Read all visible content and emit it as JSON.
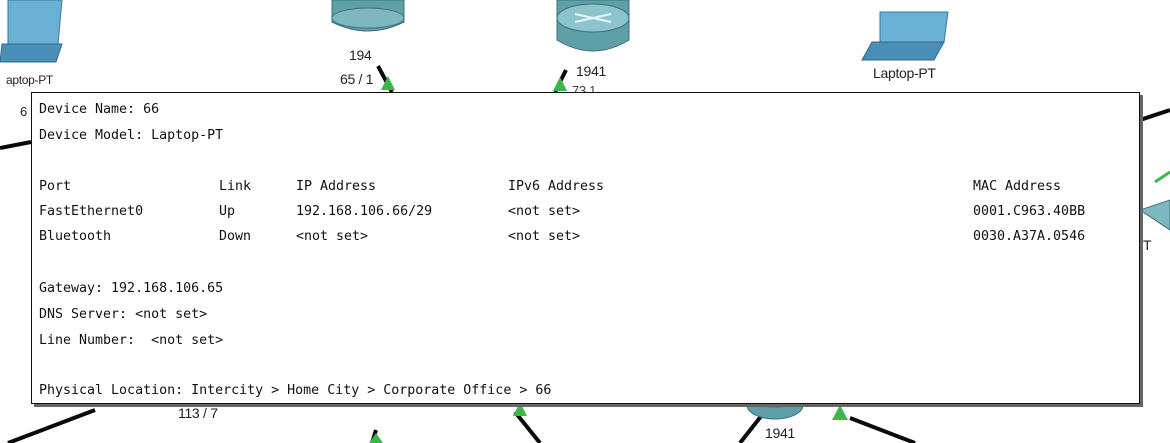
{
  "topology": {
    "labels": {
      "laptop_left_name": "aptop-PT",
      "laptop_left_sub": "6",
      "router1_model": "194",
      "router1_link": "65  / 1",
      "router2_model": "1941",
      "router2_link": "73.1",
      "laptop_right_name": "Laptop-PT",
      "right_edge_fragment": "T",
      "bottom_left_link": "113 / 7",
      "bottom_router_model": "1941"
    },
    "colors": {
      "link": "#0a0a0a",
      "link_up": "#3cb54a",
      "router": "#5f9fa8",
      "laptop": "#4a8fb5"
    }
  },
  "tooltip": {
    "device_name": "Device Name: 66",
    "device_model": "Device Model: Laptop-PT",
    "headers": {
      "port": "Port",
      "link": "Link",
      "ip": "IP Address",
      "ipv6": "IPv6 Address",
      "mac": "MAC Address"
    },
    "rows": [
      {
        "port": "FastEthernet0",
        "link": "Up",
        "ip": "192.168.106.66/29",
        "ipv6": "<not set>",
        "mac": "0001.C963.40BB"
      },
      {
        "port": "Bluetooth",
        "link": "Down",
        "ip": "<not set>",
        "ipv6": "<not set>",
        "mac": "0030.A37A.0546"
      }
    ],
    "gateway": "Gateway: 192.168.106.65",
    "dns": "DNS Server: <not set>",
    "line_number": "Line Number:  <not set>",
    "physical_location": "Physical Location: Intercity > Home City > Corporate Office > 66"
  }
}
